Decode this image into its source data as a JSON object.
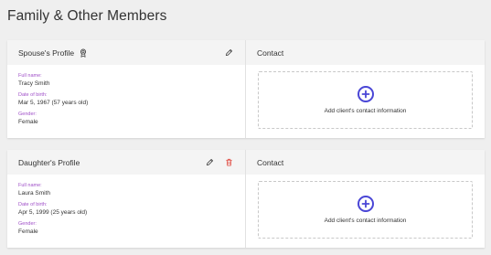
{
  "page": {
    "title": "Family & Other Members"
  },
  "members": [
    {
      "profile_title": "Spouse's Profile",
      "fields": [
        {
          "label": "Full name:",
          "value": "Tracy Smith"
        },
        {
          "label": "Date of birth:",
          "value": "Mar 5, 1967 (57 years old)"
        },
        {
          "label": "Gender:",
          "value": "Female"
        }
      ],
      "contact_title": "Contact",
      "contact_action": "Add client's contact information"
    },
    {
      "profile_title": "Daughter's Profile",
      "fields": [
        {
          "label": "Full name:",
          "value": "Laura Smith"
        },
        {
          "label": "Date of birth:",
          "value": "Apr 5, 1999 (25 years old)"
        },
        {
          "label": "Gender:",
          "value": "Female"
        }
      ],
      "contact_title": "Contact",
      "contact_action": "Add client's contact information"
    }
  ],
  "colors": {
    "accent": "#4a46d6",
    "label": "#a050c8",
    "delete": "#e0483e"
  },
  "icons": {
    "edit": "pencil-icon",
    "delete": "trash-icon",
    "spouse_badge": "award-ribbon-icon",
    "add": "plus-circle-icon"
  }
}
